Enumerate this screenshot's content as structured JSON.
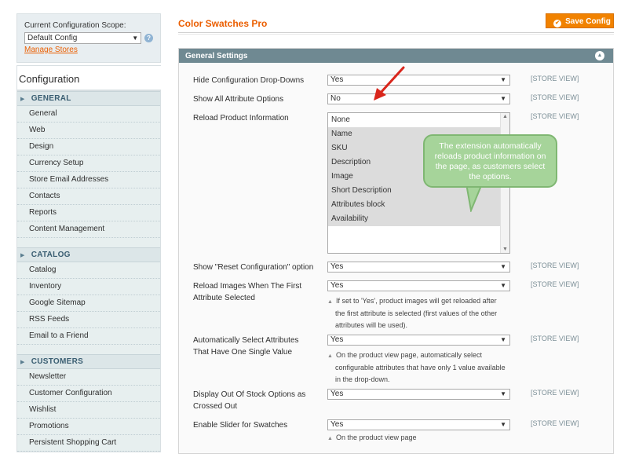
{
  "scope": {
    "label": "Current Configuration Scope:",
    "value": "Default Config",
    "manage_link": "Manage Stores"
  },
  "sidebar": {
    "title": "Configuration",
    "sections": [
      {
        "name": "GENERAL",
        "items": [
          "General",
          "Web",
          "Design",
          "Currency Setup",
          "Store Email Addresses",
          "Contacts",
          "Reports",
          "Content Management"
        ]
      },
      {
        "name": "CATALOG",
        "items": [
          "Catalog",
          "Inventory",
          "Google Sitemap",
          "RSS Feeds",
          "Email to a Friend"
        ]
      },
      {
        "name": "CUSTOMERS",
        "items": [
          "Newsletter",
          "Customer Configuration",
          "Wishlist",
          "Promotions",
          "Persistent Shopping Cart"
        ]
      }
    ]
  },
  "header": {
    "title": "Color Swatches Pro",
    "save_label": "Save Config"
  },
  "group": {
    "title": "General Settings"
  },
  "fields": {
    "hide_dropdowns": {
      "label": "Hide Configuration Drop-Downs",
      "value": "Yes",
      "scope": "[STORE VIEW]"
    },
    "show_all": {
      "label": "Show All Attribute Options",
      "value": "No",
      "scope": "[STORE VIEW]"
    },
    "reload_info": {
      "label": "Reload Product Information",
      "scope": "[STORE VIEW]",
      "options": [
        "None",
        "Name",
        "SKU",
        "Description",
        "Image",
        "Short Description",
        "Attributes block",
        "Availability"
      ]
    },
    "reset_option": {
      "label": "Show \"Reset Configuration\" option",
      "value": "Yes",
      "scope": "[STORE VIEW]"
    },
    "reload_images": {
      "label_1": "Reload Images When The First",
      "label_2": "Attribute Selected",
      "value": "Yes",
      "scope": "[STORE VIEW]",
      "note_1": "If set to 'Yes', product images will get reloaded after",
      "note_2": "the first attribute is selected (first values of the other",
      "note_3": "attributes will be used)."
    },
    "auto_select": {
      "label_1": "Automatically Select Attributes",
      "label_2": "That Have One Single Value",
      "value": "Yes",
      "scope": "[STORE VIEW]",
      "note_1": "On the product view page, automatically select",
      "note_2": "configurable attributes that have only 1 value available",
      "note_3": "in the drop-down."
    },
    "out_of_stock": {
      "label_1": "Display Out Of Stock Options as",
      "label_2": "Crossed Out",
      "value": "Yes",
      "scope": "[STORE VIEW]"
    },
    "slider": {
      "label": "Enable Slider for Swatches",
      "value": "Yes",
      "scope": "[STORE VIEW]",
      "note": "On the product view page"
    }
  },
  "callout": {
    "text": "The extension automatically reloads product information on the page, as customers select the options."
  },
  "colors": {
    "accent": "#eb5e00",
    "save_button": "#f18200",
    "fieldset_header": "#6f8992",
    "callout": "#a6d49a",
    "arrow": "#d9261c"
  }
}
